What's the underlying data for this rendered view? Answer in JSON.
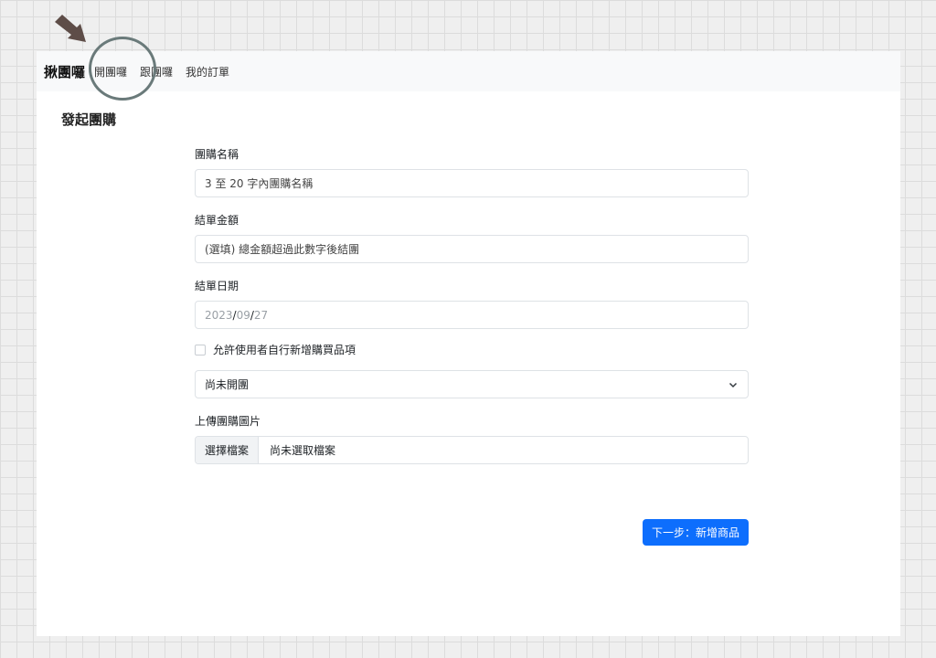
{
  "navbar": {
    "brand": "揪團囉",
    "links": [
      "開團囉",
      "跟團囉",
      "我的訂單"
    ]
  },
  "page": {
    "title": "發起團購"
  },
  "form": {
    "name": {
      "label": "團購名稱",
      "placeholder": "3 至 20 字內團購名稱"
    },
    "amount": {
      "label": "結單金額",
      "placeholder": "(選填) 總金額超過此數字後結團"
    },
    "date": {
      "label": "結單日期",
      "year": "2023",
      "month": "09",
      "day": "27",
      "sep": "/"
    },
    "allow_add": {
      "label": "允許使用者自行新增購買品項",
      "checked": false
    },
    "status": {
      "selected": "尚未開團"
    },
    "image": {
      "label": "上傳團購圖片",
      "button": "選擇檔案",
      "text": "尚未選取檔案"
    },
    "submit": "下一步：新增商品"
  },
  "colors": {
    "primary": "#0d6efd",
    "navbar_bg": "#f8f9fa",
    "annotation": "#6a7a7a",
    "arrow": "#5e4d48"
  }
}
